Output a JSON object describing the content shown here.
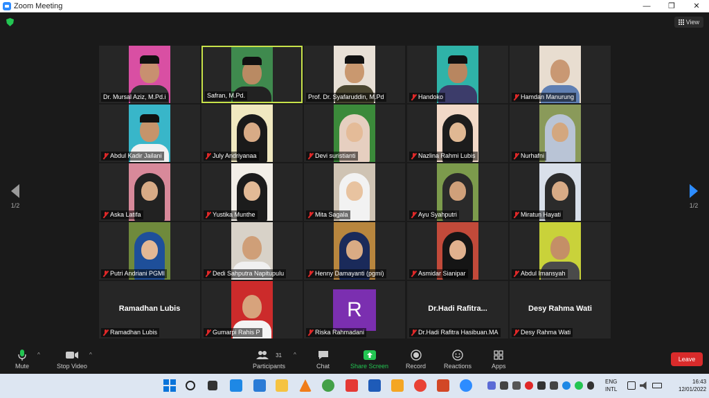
{
  "window": {
    "title": "Zoom Meeting"
  },
  "view_label": "View",
  "pager": {
    "left": "1/2",
    "right": "1/2"
  },
  "participants": [
    {
      "name": "Dr. Mursal Aziz, M.Pd.i",
      "muted": false,
      "bg": "#d94fa3",
      "skin": "#c89070",
      "shirt": "#333333",
      "cap": true
    },
    {
      "name": "Safran, M.Pd.",
      "muted": false,
      "bg": "#3f8a4e",
      "skin": "#b98a63",
      "shirt": "#222222",
      "cap": true,
      "active": true
    },
    {
      "name": "Prof. Dr. Syafaruddin, M.Pd",
      "muted": false,
      "bg": "#e8e0d6",
      "skin": "#c9986f",
      "shirt": "#4a4630",
      "cap": true
    },
    {
      "name": "Handoko",
      "muted": true,
      "bg": "#2fb3a8",
      "skin": "#b88660",
      "shirt": "#3c3c6a",
      "cap": true
    },
    {
      "name": "Hamdan Manurung",
      "muted": true,
      "bg": "#e8ddd0",
      "skin": "#c99873",
      "shirt": "#5f7fb3",
      "cap": false
    },
    {
      "name": "Abdul Kadir Jailani",
      "muted": true,
      "bg": "#38b6c9",
      "skin": "#c6946b",
      "shirt": "#f2f2f2",
      "cap": true
    },
    {
      "name": "July Andriyanaa",
      "muted": true,
      "bg": "#f0e8c0",
      "skin": "#d8ab86",
      "hijab": "#1a1a1a"
    },
    {
      "name": "Devi suristianti",
      "muted": true,
      "bg": "#3b8a3a",
      "skin": "#e4bb98",
      "hijab": "#e6cfc0"
    },
    {
      "name": "Nazlina Rahmi Lubis",
      "muted": true,
      "bg": "#f2d9c8",
      "skin": "#e0b893",
      "hijab": "#1c1c1c"
    },
    {
      "name": "Nurhafni",
      "muted": true,
      "bg": "#8a9a5a",
      "skin": "#d3a77f",
      "hijab": "#b9c4d6"
    },
    {
      "name": "Aska Latifa",
      "muted": true,
      "bg": "#d8899a",
      "skin": "#d8ab86",
      "hijab": "#222222"
    },
    {
      "name": "Yustika Munthe",
      "muted": true,
      "bg": "#f3efe8",
      "skin": "#e3ba96",
      "hijab": "#1c1c1c"
    },
    {
      "name": "Mita Sagala",
      "muted": true,
      "bg": "#cfc3b3",
      "skin": "#e8c3a0",
      "hijab": "#f2f2f2"
    },
    {
      "name": "Ayu Syahputri",
      "muted": true,
      "bg": "#7c9b4c",
      "skin": "#cfa07a",
      "hijab": "#2a2a2a"
    },
    {
      "name": "Miratun Hayati",
      "muted": true,
      "bg": "#d9e0ea",
      "skin": "#d8ab86",
      "hijab": "#2b2b2b"
    },
    {
      "name": "Putri Andriani PGMI",
      "muted": true,
      "bg": "#6f8a3c",
      "skin": "#e3b895",
      "hijab": "#1e4f9a"
    },
    {
      "name": "Dedi Sahputra Napitupulu",
      "muted": true,
      "bg": "#d8d2c8",
      "skin": "#cf9f78",
      "shirt": "#f0f0f0",
      "cap": false
    },
    {
      "name": "Henny Damayanti (pgmi)",
      "muted": true,
      "bg": "#b8863e",
      "skin": "#d9ab84",
      "hijab": "#1a2a5a"
    },
    {
      "name": "Asmidar Sianipar",
      "muted": true,
      "bg": "#c24a3a",
      "skin": "#e0b18e",
      "hijab": "#151515"
    },
    {
      "name": "Abdul Imansyah",
      "muted": true,
      "bg": "#c9d23a",
      "skin": "#c48f67",
      "shirt": "#4a4a4a",
      "cap": false
    },
    {
      "name": "Ramadhan Lubis",
      "muted": true,
      "placeholder": "Ramadhan Lubis"
    },
    {
      "name": "Gumarpi Rahis P",
      "muted": true,
      "bg": "#cc2b2b",
      "skin": "#d7a37c",
      "shirt": "#f4f4f4",
      "cap": false
    },
    {
      "name": "Riska Rahmadani",
      "muted": true,
      "avatar": "R"
    },
    {
      "name": "Dr.Hadi Rafitra Hasibuan.MA",
      "muted": true,
      "placeholder": "Dr.Hadi  Rafitra..."
    },
    {
      "name": "Desy Rahma Wati",
      "muted": true,
      "placeholder": "Desy Rahma Wati"
    }
  ],
  "toolbar": {
    "mute": "Mute",
    "stop_video": "Stop Video",
    "participants": "Participants",
    "participants_count": "31",
    "chat": "Chat",
    "share_screen": "Share Screen",
    "record": "Record",
    "reactions": "Reactions",
    "apps": "Apps",
    "leave": "Leave"
  },
  "tray": {
    "lang1": "ENG",
    "lang2": "INTL",
    "time": "16:43",
    "date": "12/01/2022"
  }
}
